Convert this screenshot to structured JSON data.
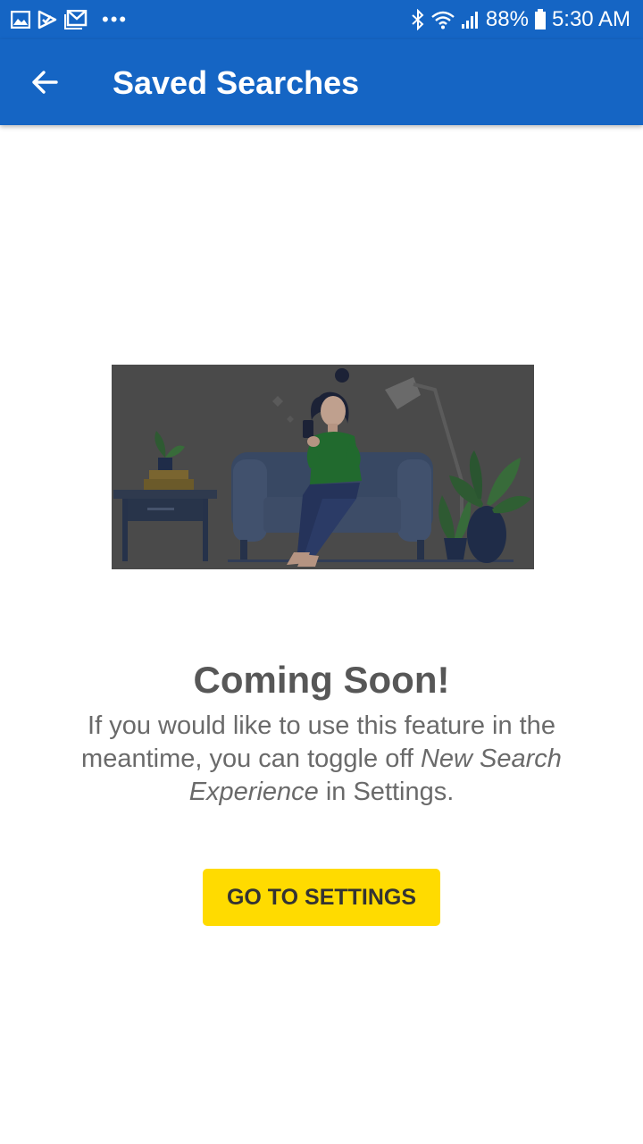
{
  "status_bar": {
    "left_icons": [
      "gallery-icon",
      "check-notification-icon",
      "gmail-icon"
    ],
    "more_indicator": "•••",
    "battery": "88%",
    "time": "5:30 AM",
    "right_icons": [
      "bluetooth-icon",
      "wifi-icon",
      "signal-icon",
      "battery-icon"
    ]
  },
  "app_bar": {
    "title": "Saved Searches",
    "back_icon": "arrow-left-icon",
    "color": "#1565c4"
  },
  "empty_state": {
    "illustration": "woman-sitting-on-sofa-with-phone-illustration",
    "heading": "Coming Soon!",
    "message_part1": "If you would like to use this feature in the meantime, you can toggle off ",
    "message_emphasis": "New Search Experience",
    "message_part2": " in Settings.",
    "button_label": "GO TO SETTINGS",
    "button_color": "#ffdb00"
  }
}
